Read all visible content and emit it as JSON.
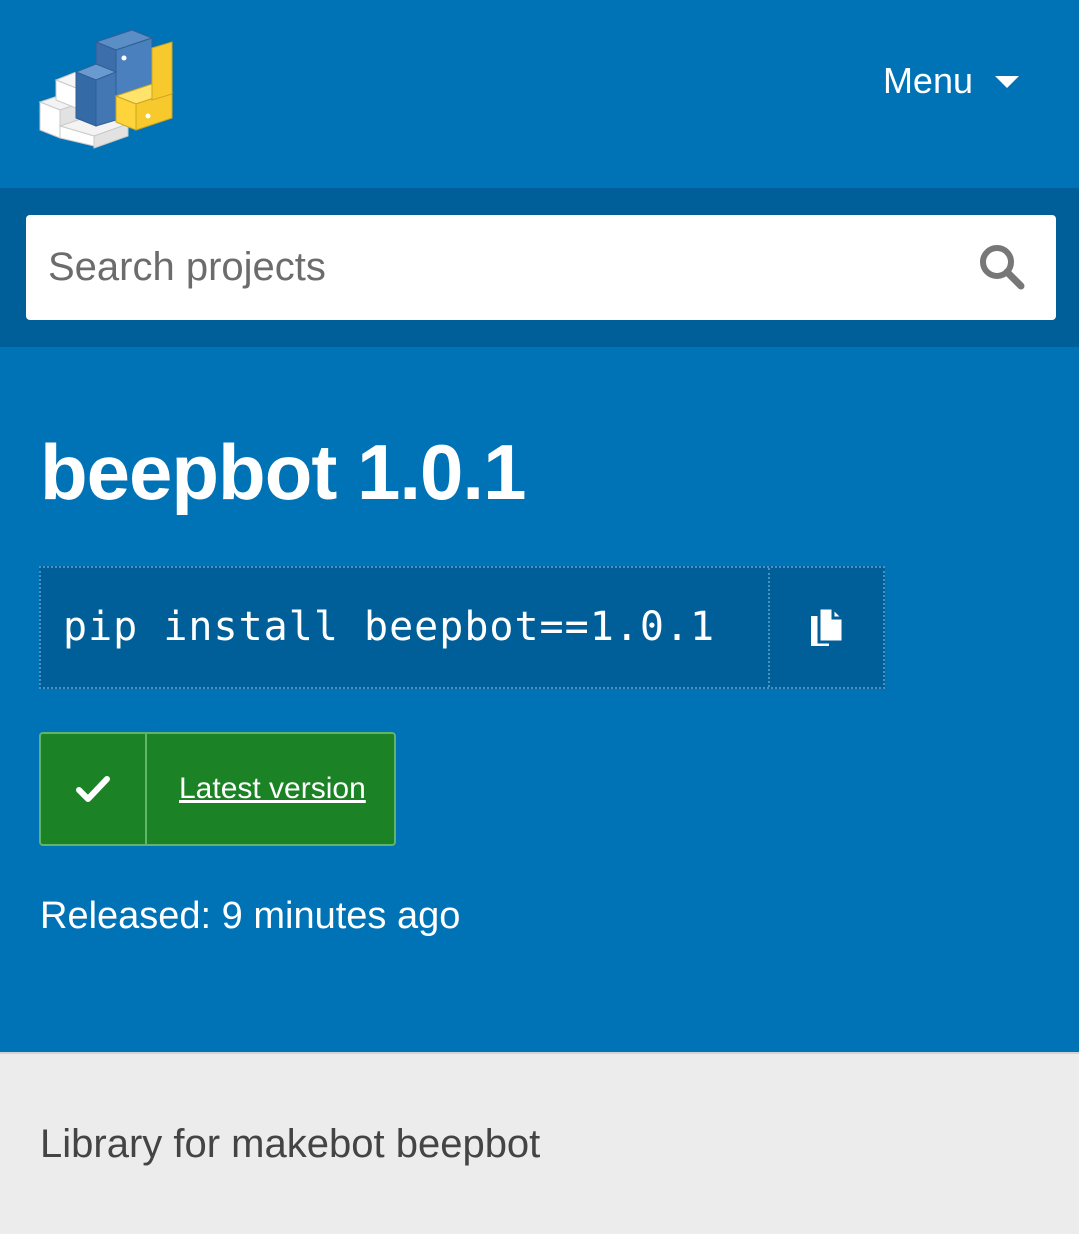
{
  "header": {
    "logo": "pypi-logo",
    "menu_label": "Menu",
    "menu_icon": "caret-down-icon"
  },
  "search": {
    "placeholder": "Search projects",
    "icon": "search-icon"
  },
  "project": {
    "title": "beepbot 1.0.1",
    "pip_command": "pip install beepbot==1.0.1",
    "copy_icon": "copy-icon",
    "badge_icon": "check-icon",
    "latest_label": "Latest version",
    "released": "Released: 9 minutes ago",
    "summary": "Library for makebot beepbot"
  },
  "colors": {
    "header_bg": "#0073b7",
    "search_band_bg": "#005f98",
    "badge_green": "#1b8225",
    "page_bg": "#ececec"
  }
}
